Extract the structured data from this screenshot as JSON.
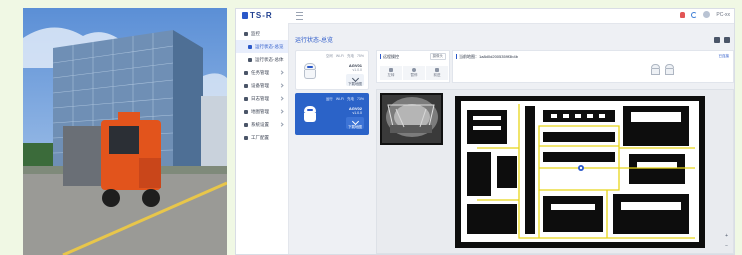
{
  "app": {
    "logo": "TS-R",
    "user_name": "PC-xx"
  },
  "sidebar": {
    "items": [
      {
        "label": "监控"
      },
      {
        "label": "运行状态-总览"
      },
      {
        "label": "运行状态-总体"
      },
      {
        "label": "任务管理"
      },
      {
        "label": "设备管理"
      },
      {
        "label": "日志管理"
      },
      {
        "label": "地图管理"
      },
      {
        "label": "系统设置"
      },
      {
        "label": "工厂配置"
      }
    ]
  },
  "main": {
    "page_title": "运行状态-总览"
  },
  "robot_cards": [
    {
      "stats": [
        "空闲",
        "Wi-Fi",
        "充电",
        "75%"
      ],
      "name": "AGV01",
      "version": "v1.0.0",
      "download_label": "下载地图"
    },
    {
      "stats": [
        "运行",
        "Wi-Fi",
        "充电",
        "73%"
      ],
      "name": "AGV02",
      "version": "v1.0.0",
      "download_label": "下载地图"
    }
  ],
  "camera_panel": {
    "label": "远程操控",
    "button_label": "摄像头",
    "controls": [
      "左转",
      "暂停",
      "前进"
    ]
  },
  "map_panel": {
    "label": "当前地图：1a8d0d2005359f3b4b",
    "link_label": "已连接"
  },
  "viewer": {
    "zoom_in": "+",
    "zoom_out": "−"
  },
  "colors": {
    "accent": "#2a58c9",
    "sidebar_active_bg": "#e8eefc",
    "selected_card": "#2b63c8",
    "route": "#e7d51a"
  }
}
